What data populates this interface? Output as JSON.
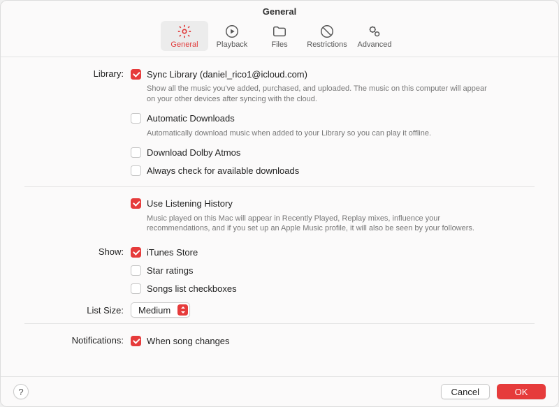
{
  "title": "General",
  "tabs": {
    "general": "General",
    "playback": "Playback",
    "files": "Files",
    "restrictions": "Restrictions",
    "advanced": "Advanced"
  },
  "labels": {
    "library": "Library:",
    "show": "Show:",
    "list_size": "List Size:",
    "notifications": "Notifications:"
  },
  "library": {
    "sync_label": "Sync Library (daniel_rico1@icloud.com)",
    "sync_desc": "Show all the music you've added, purchased, and uploaded. The music on this computer will appear on your other devices after syncing with the cloud.",
    "auto_dl_label": "Automatic Downloads",
    "auto_dl_desc": "Automatically download music when added to your Library so you can play it offline.",
    "atmos_label": "Download Dolby Atmos",
    "avail_label": "Always check for available downloads"
  },
  "history": {
    "label": "Use Listening History",
    "desc": "Music played on this Mac will appear in Recently Played, Replay mixes, influence your recommendations, and if you set up an Apple Music profile, it will also be seen by your followers."
  },
  "show": {
    "itunes": "iTunes Store",
    "stars": "Star ratings",
    "songs_cb": "Songs list checkboxes"
  },
  "list_size": {
    "value": "Medium"
  },
  "notifications": {
    "song_changes": "When song changes"
  },
  "buttons": {
    "help": "?",
    "cancel": "Cancel",
    "ok": "OK"
  },
  "colors": {
    "accent": "#e63b3b"
  }
}
